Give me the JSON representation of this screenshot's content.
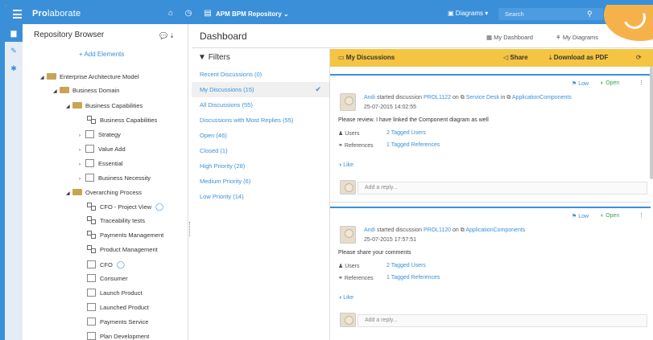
{
  "topbar": {
    "logo_bold": "Pro",
    "logo_rest": "laborate",
    "repository": "APM BPM Repository",
    "diagrams_menu": "Diagrams",
    "search_placeholder": "Search"
  },
  "tree": {
    "title": "Repository Browser",
    "add_elements": "+ Add Elements",
    "nodes": [
      "Enterprise Architecture Model",
      "Business Domain",
      "Business Capabilities",
      "Business Capabilities",
      "Strategy",
      "Value Add",
      "Essential",
      "Business Necessity",
      "Overarching Process",
      "CFO - Project View",
      "Traceability tests",
      "Payments Management",
      "Product Management",
      "CFO",
      "Consumer",
      "Launch Product",
      "Launched Product",
      "Payments Service",
      "Plan Development"
    ]
  },
  "dashboard": {
    "title": "Dashboard",
    "my_dashboard": "My Dashboard",
    "my_diagrams": "My Diagrams"
  },
  "filters": {
    "title": "Filters",
    "items": [
      "Recent Discussions (0)",
      "My Discussions (15)",
      "All Discussions (55)",
      "Discussions with Most Replies (55)",
      "Open (46)",
      "Closed (1)",
      "High Priority (28)",
      "Medium Priority (6)",
      "Low Priority (14)"
    ]
  },
  "discussions": {
    "title": "My Discussions",
    "share": "Share",
    "download": "Download as PDF",
    "cards": [
      {
        "priority": "Low",
        "status": "Open",
        "author": "Andi",
        "action": "started discussion",
        "id": "PROL1122",
        "on": "on",
        "target": "Service Desk",
        "in": "in",
        "scope": "ApplicationComponents",
        "date": "25-07-2015 14:02:55",
        "message": "Please review. I have linked the Component diagram as well",
        "users_label": "Users",
        "users_value": "2 Tagged Users",
        "refs_label": "References",
        "refs_value": "1 Tagged References",
        "like": "Like",
        "reply": "Add a reply..."
      },
      {
        "priority": "Low",
        "status": "Open",
        "author": "Andi",
        "action": "started discussion",
        "id": "PROL1120",
        "on": "on",
        "target": "ApplicationComponents",
        "in": "",
        "scope": "",
        "date": "25-07-2015 17:57:51",
        "message": "Please share your comments",
        "users_label": "Users",
        "users_value": "2 Tagged Users",
        "refs_label": "References",
        "refs_value": "1 Tagged References",
        "like": "Like",
        "reply": "Add a reply..."
      }
    ]
  },
  "colors": {
    "accent": "#3b8fd9",
    "bar": "#f4c542",
    "open": "#3aa655"
  }
}
